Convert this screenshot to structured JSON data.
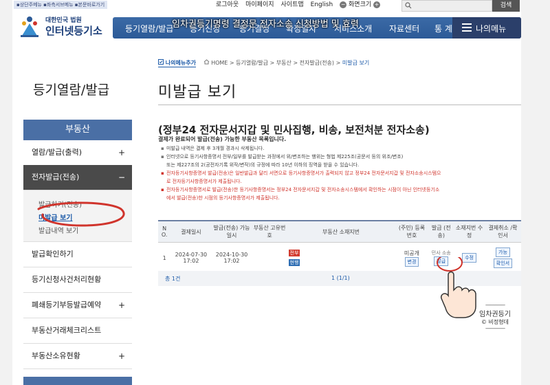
{
  "topbar": {
    "skip_links": "▪상단주메뉴  ▪좌측서브메뉴  ▪본문바로가기",
    "util_links": [
      "로그아웃",
      "마이페이지",
      "사이트맵",
      "English"
    ],
    "zoom_label": "화면크기",
    "zoom_minus": "−",
    "zoom_plus": "+",
    "search_button": "검색"
  },
  "logo": {
    "sub": "대한민국 법원",
    "main": "인터넷등기소"
  },
  "nav": {
    "items": [
      "등기열람/발급",
      "등기신청",
      "등기결정",
      "확정일자",
      "서비스소개",
      "자료센터",
      "통 계"
    ],
    "mymenu": "나의메뉴",
    "overlay_title": "임차권등기명령 결정문 전자소송 신청방법 및 효력"
  },
  "sidebar": {
    "title": "등기열람/발급",
    "section": "부동산",
    "items": [
      {
        "label": "열람/발급(출력)",
        "plus": "+"
      },
      {
        "label": "전자발급(전송)",
        "plus": "−"
      },
      {
        "label": "발급확인하기",
        "plus": ""
      },
      {
        "label": "등기신청사건처리현황",
        "plus": ""
      },
      {
        "label": "폐쇄등기부등발급예약",
        "plus": "+"
      },
      {
        "label": "부동산거래체크리스트",
        "plus": ""
      },
      {
        "label": "부동산소유현황",
        "plus": "+"
      }
    ],
    "submenu": [
      "발급하기(전송)",
      "미발급 보기",
      "발급내역 보기"
    ]
  },
  "breadcrumb": {
    "myadd": "나의메뉴추가",
    "path": "HOME > 등기열람/발급 > 부동산 > 전자발급(전송) >",
    "current": "미발급 보기"
  },
  "main": {
    "title": "미발급 보기",
    "subheading": "(정부24 전자문서지갑 및 민사집행, 비송, 보전처분 전자소송)",
    "description": "결제가 완료되어 발급(전송) 가능한 부동산 목록입니다.",
    "notes": [
      {
        "text": "미발급 내역은 결제 후 3개월 경과시 삭제됩니다.",
        "red": false
      },
      {
        "text": "인터넷으로 등기사항증명서 전부/일부를 발급받는 과정에서 위/변조하는 행위는 형법 제225조(공문서 등의 위조/변조)",
        "red": false
      },
      {
        "text": "또는 제227조의 2(공전자기록 위작/변작)의 규정에 따라 10년 이하의 징역을 받을 수 있습니다.",
        "red": false,
        "cont": true
      },
      {
        "text": "전자등기사항증명서 발급(전송)은 일반발급과 달리 서면으로 등기사항증명서가 출력되지 않고 정부24 전자문서지갑 및 전자소송시스템으",
        "red": true
      },
      {
        "text": "로 전자등기사항증명서가 제출됩니다.",
        "red": true,
        "cont": true
      },
      {
        "text": "전자등기사항증명서로 발급(전송)한 등기사항증명서는 정부24 전자문서지갑 및 전자소송시스템에서 확인하는 시점이 아닌 인터넷등기소",
        "red": true
      },
      {
        "text": "에서 발급(전송)한 시점의 등기사항증명서가 제출됩니다.",
        "red": true,
        "cont": true
      }
    ]
  },
  "table": {
    "headers": [
      "N O.",
      "결제일시",
      "발급(전송) 가능일시",
      "부동산 고유번호",
      "부동산 소재지번",
      "(주민) 등록번호",
      "발급 (전송)",
      "소재지번 수정",
      "결제취소 /확인서"
    ],
    "row": {
      "no": "1",
      "paid_at": "2024-07-30 17:02",
      "available_at": "2024-10-30 17:02",
      "unique_no": "",
      "tag1": "전부",
      "tag2": "현행",
      "reg_no": "미공개",
      "reg_btn": "변경",
      "issue_text": "민사 소송",
      "issue_btn": "발급",
      "edit_btn": "수정",
      "cancel_btn": "가능",
      "confirm_btn": "확인서"
    },
    "total": "총 1건",
    "pages": "1  (1/1)"
  },
  "watermark": {
    "line1": "임차권등기",
    "line2": "© 비정형데"
  },
  "colors": {
    "nav": "#2c5a97",
    "side_head": "#4a6fa5",
    "accent_red": "#d0342c",
    "link_blue": "#1c5aa8"
  }
}
